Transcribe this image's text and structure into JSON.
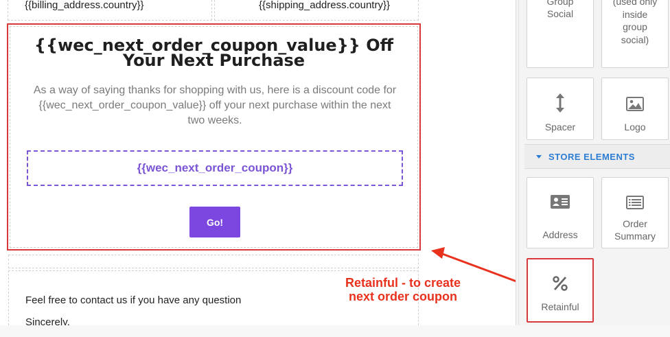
{
  "email": {
    "billing_country": "{{billing_address.country}}",
    "shipping_country": "{{shipping_address.country}}",
    "coupon": {
      "title": "{{wec_next_order_coupon_value}} Off Your Next Purchase",
      "description": "As a way of saying thanks for shopping with us, here is a discount code for {{wec_next_order_coupon_value}} off your next purchase within the next two weeks.",
      "code": "{{wec_next_order_coupon}}",
      "button_label": "Go!"
    },
    "footer": {
      "contact": "Feel free to contact us if you have any question",
      "sincerely": "Sincerely,"
    }
  },
  "annotation": {
    "text": "Retainful - to create\n next order coupon"
  },
  "panel": {
    "group_social_label": "Group\nSocial",
    "social_inside_label": "(used only\ninside\ngroup\nsocial)",
    "spacer_label": "Spacer",
    "logo_label": "Logo",
    "store_section_title": "STORE ELEMENTS",
    "address_label": "Address",
    "order_summary_label": "Order\nSummary",
    "retainful_label": "Retainful"
  },
  "icons": {
    "spacer": "vertical-resize-icon",
    "logo": "image-icon",
    "address": "address-card-icon",
    "order_summary": "list-icon",
    "retainful": "percent-icon"
  },
  "colors": {
    "accent_purple": "#7b47e0",
    "highlight_red": "#d9383a",
    "annotation_red": "#e8321e",
    "section_blue": "#2b7cd3"
  }
}
